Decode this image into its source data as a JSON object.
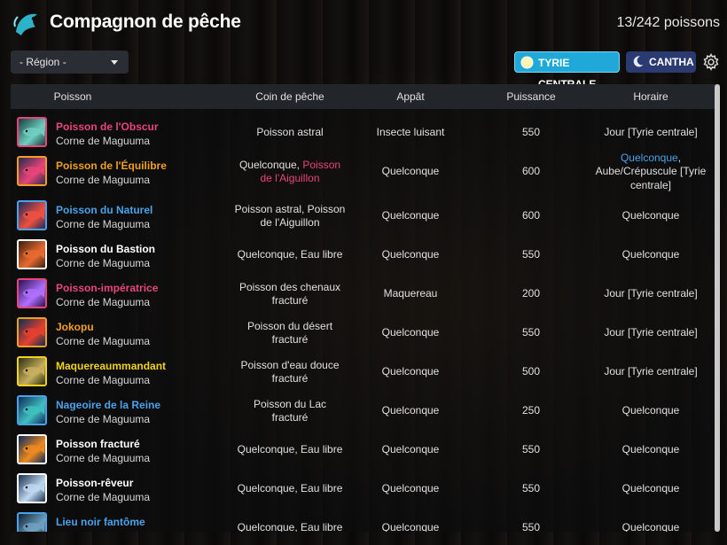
{
  "header": {
    "title": "Compagnon de pêche",
    "count": "13/242 poissons"
  },
  "filters": {
    "region": "- Région -",
    "tyrie": "TYRIE CENTRALE",
    "cantha": "CANTHA"
  },
  "columns": [
    "Poisson",
    "Coin de pêche",
    "Appât",
    "Puissance",
    "Horaire"
  ],
  "rows": [
    {
      "name": "Poisson de l'Obscur",
      "name_color": "#e8457a",
      "border": "#e8457a",
      "loc": "Corne de Maguuma",
      "spot": "Poisson astral",
      "bait": "Insecte luisant",
      "power": "550",
      "time": "Jour [Tyrie centrale]"
    },
    {
      "name": "Poisson de l'Équilibre",
      "name_color": "#f0a020",
      "border": "#f0a020",
      "loc": "Corne de Maguuma",
      "spot_a": "Quelconque, ",
      "spot_b": "Poisson de l'Aiguillon",
      "bait": "Quelconque",
      "power": "600",
      "time_a": "Quelconque",
      "time_b": ", Aube/Crépuscule [Tyrie centrale]"
    },
    {
      "name": "Poisson du Naturel",
      "name_color": "#4aa3ea",
      "border": "#4aa3ea",
      "loc": "Corne de Maguuma",
      "spot": "Poisson astral, Poisson de l'Aiguillon",
      "bait": "Quelconque",
      "power": "600",
      "time": "Quelconque"
    },
    {
      "name": "Poisson du Bastion",
      "name_color": "#ffffff",
      "border": "#ffffff",
      "loc": "Corne de Maguuma",
      "spot": "Quelconque, Eau libre",
      "bait": "Quelconque",
      "power": "550",
      "time": "Quelconque"
    },
    {
      "name": "Poisson-impératrice",
      "name_color": "#e8457a",
      "border": "#e8457a",
      "loc": "Corne de Maguuma",
      "spot": "Poisson des chenaux fracturé",
      "bait": "Maquereau",
      "power": "200",
      "time": "Jour [Tyrie centrale]"
    },
    {
      "name": "Jokopu",
      "name_color": "#f0a020",
      "border": "#f0a020",
      "loc": "Corne de Maguuma",
      "spot": "Poisson du désert fracturé",
      "bait": "Quelconque",
      "power": "550",
      "time": "Jour [Tyrie centrale]"
    },
    {
      "name": "Maquereaummandant",
      "name_color": "#f2d21a",
      "border": "#f2d21a",
      "loc": "Corne de Maguuma",
      "spot": "Poisson d'eau douce fracturé",
      "bait": "Quelconque",
      "power": "500",
      "time": "Jour [Tyrie centrale]"
    },
    {
      "name": "Nageoire de la Reine",
      "name_color": "#4aa3ea",
      "border": "#4aa3ea",
      "loc": "Corne de Maguuma",
      "spot": "Poisson du Lac fracturé",
      "bait": "Quelconque",
      "power": "250",
      "time": "Quelconque"
    },
    {
      "name": "Poisson fracturé",
      "name_color": "#ffffff",
      "border": "#ffffff",
      "loc": "Corne de Maguuma",
      "spot": "Quelconque, Eau libre",
      "bait": "Quelconque",
      "power": "550",
      "time": "Quelconque"
    },
    {
      "name": "Poisson-rêveur",
      "name_color": "#ffffff",
      "border": "#ffffff",
      "loc": "Corne de Maguuma",
      "spot": "Quelconque, Eau libre",
      "bait": "Quelconque",
      "power": "550",
      "time": "Quelconque"
    },
    {
      "name": "Lieu noir fantôme",
      "name_color": "#4aa3ea",
      "border": "#4aa3ea",
      "loc": "Corne de Maguuma",
      "spot": "Quelconque, Eau libre",
      "bait": "Quelconque",
      "power": "550",
      "time": "Quelconque"
    }
  ]
}
